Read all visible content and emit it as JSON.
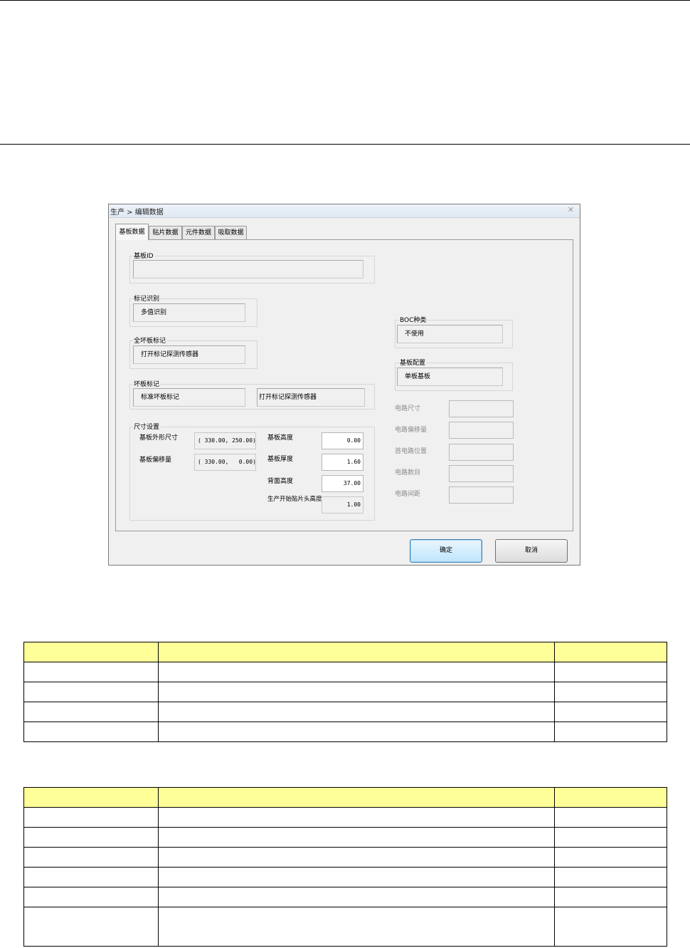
{
  "dialog": {
    "title": "生产 > 编辑数据",
    "tabs": [
      "基板数据",
      "贴片数据",
      "元件数据",
      "吸取数据"
    ],
    "active_tab_index": 0,
    "groups": {
      "board_id": {
        "label": "基板ID",
        "value": ""
      },
      "mark_recognition": {
        "label": "标记识别",
        "value": "多值识别"
      },
      "all_bad_mark": {
        "label": "全坏板标记",
        "value": "打开标记探测传感器"
      },
      "bad_board_mark": {
        "label": "坏板标记",
        "value_left": "标准坏板标记",
        "value_right": "打开标记探测传感器"
      },
      "size_settings": {
        "label": "尺寸设置",
        "outer_size_label": "基板外形尺寸",
        "outer_size_value": "( 330.00, 250.00)",
        "offset_label": "基板偏移量",
        "offset_value": "( 330.00,   0.00)",
        "height_label": "基板高度",
        "height_value": "0.00",
        "thickness_label": "基板厚度",
        "thickness_value": "1.60",
        "back_height_label": "背面高度",
        "back_height_value": "37.00",
        "head_height_label": "生产开始贴片头高度",
        "head_height_value": "1.00"
      },
      "boc_type": {
        "label": "BOC种类",
        "value": "不使用"
      },
      "board_config": {
        "label": "基板配置",
        "value": "单板基板"
      }
    },
    "circuit_fields": [
      "电路尺寸",
      "电路偏移量",
      "首电路位置",
      "电路数目",
      "电路间距"
    ],
    "ok_label": "确定",
    "cancel_label": "取消"
  },
  "table1": {
    "rows": [
      [
        "",
        "",
        ""
      ],
      [
        "",
        "",
        ""
      ],
      [
        "",
        "",
        ""
      ],
      [
        "",
        "",
        ""
      ],
      [
        "",
        "",
        ""
      ]
    ]
  },
  "table2": {
    "rows": [
      [
        "",
        "",
        ""
      ],
      [
        "",
        "",
        ""
      ],
      [
        "",
        "",
        ""
      ],
      [
        "",
        "",
        ""
      ],
      [
        "",
        "",
        ""
      ],
      [
        "",
        "",
        ""
      ],
      [
        "",
        "",
        ""
      ]
    ]
  },
  "colors": {
    "table_header": "#ffff99",
    "dialog_bg": "#f0f0f0"
  }
}
